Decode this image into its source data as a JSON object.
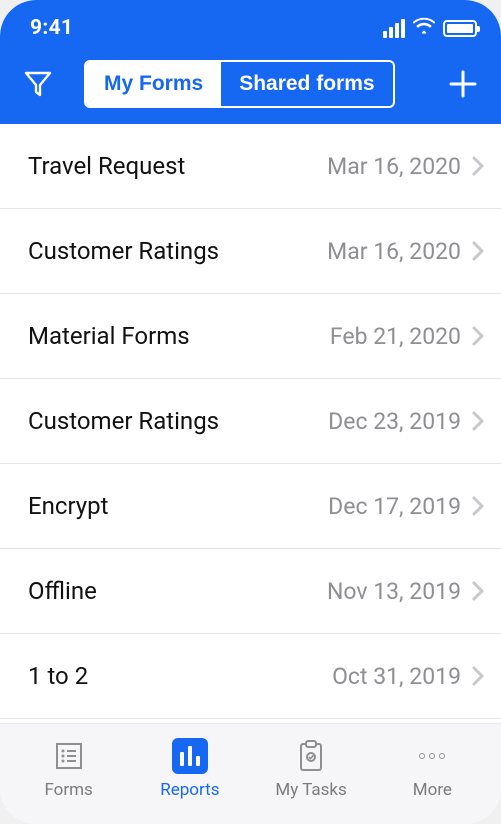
{
  "status": {
    "time": "9:41"
  },
  "toolbar": {
    "segment": {
      "myForms": "My Forms",
      "sharedForms": "Shared forms"
    }
  },
  "list": {
    "items": [
      {
        "title": "Travel Request",
        "date": "Mar 16, 2020"
      },
      {
        "title": "Customer Ratings",
        "date": "Mar 16, 2020"
      },
      {
        "title": "Material Forms",
        "date": "Feb 21, 2020"
      },
      {
        "title": "Customer Ratings",
        "date": "Dec 23, 2019"
      },
      {
        "title": "Encrypt",
        "date": "Dec 17, 2019"
      },
      {
        "title": "Offline",
        "date": "Nov 13, 2019"
      },
      {
        "title": "1 to 2",
        "date": "Oct 31, 2019"
      }
    ]
  },
  "tabs": {
    "forms": "Forms",
    "reports": "Reports",
    "mytasks": "My Tasks",
    "more": "More"
  }
}
